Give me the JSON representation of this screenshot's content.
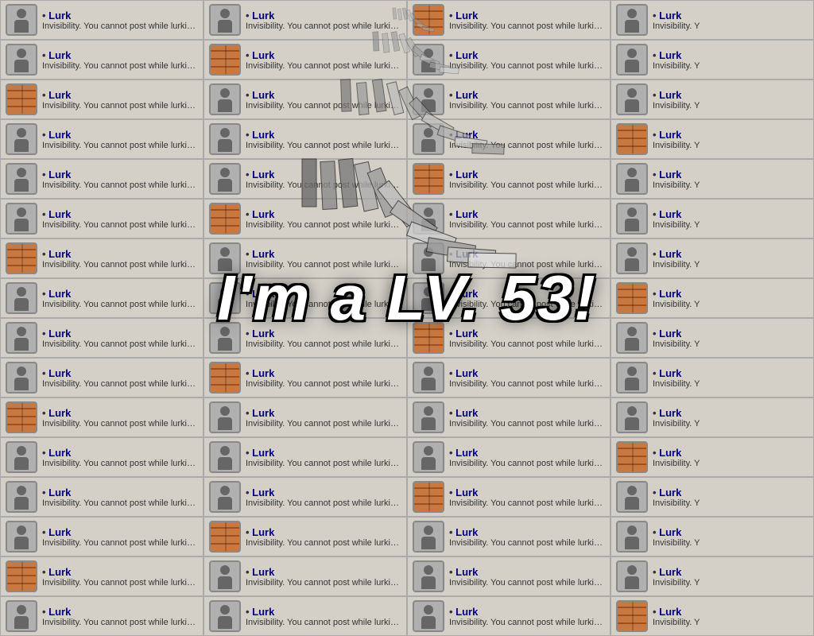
{
  "overlay": {
    "text": "I'm a LV. 53!"
  },
  "cell": {
    "name": "Lurk",
    "desc": "Invisibility. You cannot post while lurking.",
    "desc_short": "Invisibility. Y"
  },
  "grid": {
    "rows": 16,
    "cols": 4
  }
}
